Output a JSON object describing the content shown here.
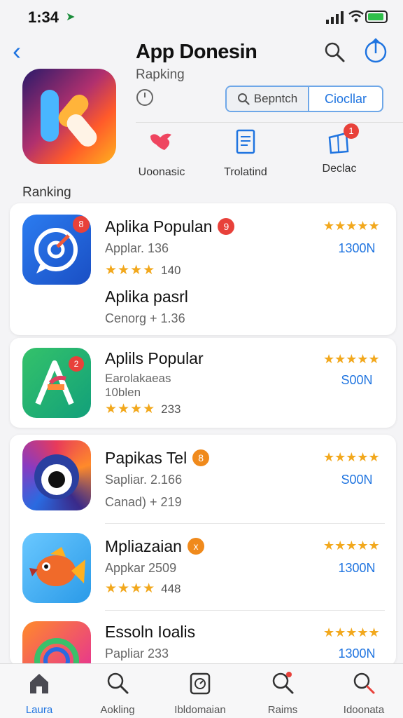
{
  "status": {
    "time": "1:34"
  },
  "header": {
    "title": "App Donesin",
    "subtitle": "Rapking",
    "segment": {
      "left": "Bepntch",
      "right": "Ciocllar"
    }
  },
  "actions": [
    {
      "label": "Uoonasic"
    },
    {
      "label": "Trolatind"
    },
    {
      "label": "Declac",
      "badge": "1"
    }
  ],
  "section_label": "Ranking",
  "apps": [
    {
      "name": "Aplika Populan",
      "badge": "9",
      "meta": "Applar. 136",
      "stars": "★★★★",
      "star_count": "140",
      "count": "1300N"
    },
    {
      "name": "Aplika pasrl",
      "meta": "Cenorg + 1.36"
    },
    {
      "name": "Aplils Popular",
      "meta": "Earolakaeas\n10blen",
      "meta1": "Earolakaeas",
      "meta2": "10blen",
      "stars": "★★★★",
      "star_count": "233",
      "count": "S00N"
    },
    {
      "name": "Papikas Tel",
      "badge": "8",
      "meta": "Sapliar. 2.166",
      "sub": "Canad) + 219",
      "count": "S00N"
    },
    {
      "name": "Mpliazaian",
      "badge": "x",
      "meta": "Appkar 2509",
      "stars": "★★★★",
      "star_count": "448",
      "count": "1300N"
    },
    {
      "name": "Essoln Ioalis",
      "meta": "Papliar 233",
      "count": "1300N"
    }
  ],
  "right_stars": "★★★★★",
  "tabs": [
    {
      "label": "Laura"
    },
    {
      "label": "Aokling"
    },
    {
      "label": "Ibldomaian"
    },
    {
      "label": "Raims"
    },
    {
      "label": "Idoonata"
    }
  ],
  "colors": {
    "accent": "#1f74e0",
    "badge_red": "#e8413a",
    "badge_orange": "#f08a1c",
    "star": "#f2a81d"
  }
}
